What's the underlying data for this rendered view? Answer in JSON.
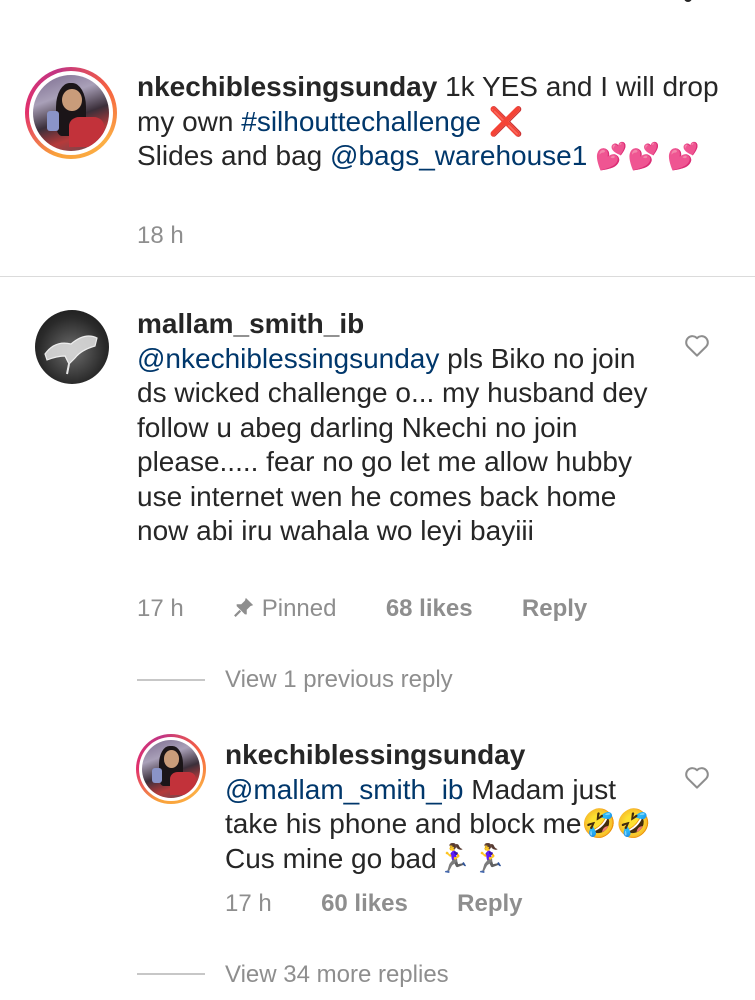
{
  "caption": {
    "username": "nkechiblessingsunday",
    "text_before": "1k YES and I will drop my own",
    "hashtag": "#silhouttechallenge",
    "x_emoji": "❌",
    "text_mid": "Slides and bag",
    "mention": "@bags_warehouse1",
    "hearts": "💕💕 💕",
    "time": "18 h"
  },
  "comment": {
    "username": "mallam_smith_ib",
    "mention": "@nkechiblessingsunday",
    "text": "pls Biko no join ds wicked challenge o... my husband dey follow u abeg darling Nkechi no join please..... fear no go let me allow hubby use internet wen he comes back home now abi iru wahala wo leyi bayiii",
    "time": "17 h",
    "pinned_label": "Pinned",
    "likes": "68 likes",
    "reply_label": "Reply"
  },
  "view_previous": "View 1 previous reply",
  "reply": {
    "username": "nkechiblessingsunday",
    "mention": "@mallam_smith_ib",
    "text": "Madam just take his phone and block me🤣🤣 Cus mine go bad🏃‍♀️🏃‍♀️",
    "time": "17 h",
    "likes": "60 likes",
    "reply_label": "Reply"
  },
  "view_more": "View 34 more replies",
  "icons": {
    "heart_outline": "heart-outline-icon",
    "pin": "pin-icon"
  },
  "colors": {
    "link": "#00376b",
    "meta": "#8e8e8e",
    "divider": "#dbdbdb"
  }
}
